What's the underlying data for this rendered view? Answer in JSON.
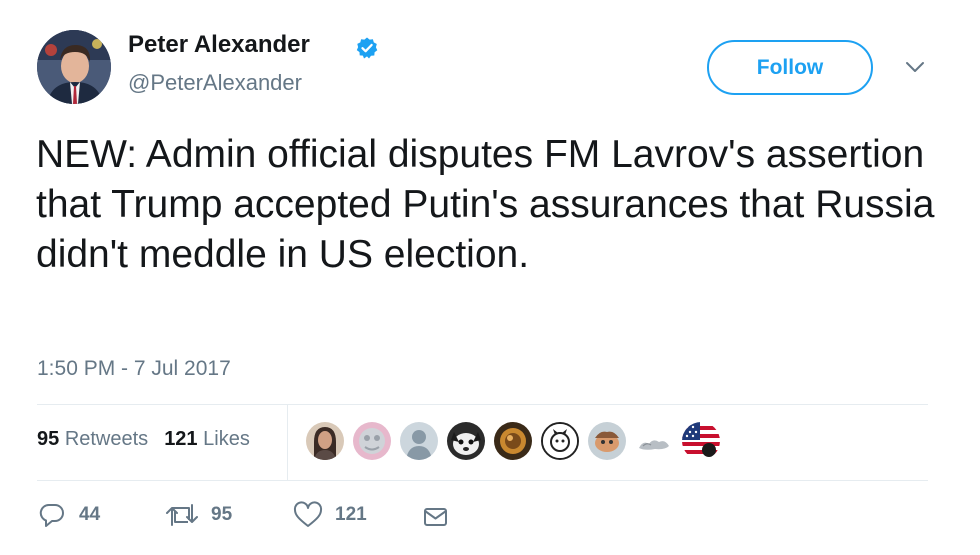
{
  "tweet": {
    "author": {
      "name": "Peter Alexander",
      "handle": "@PeterAlexander",
      "verified": true
    },
    "follow_label": "Follow",
    "text": "NEW: Admin official disputes FM Lavrov's assertion that Trump accepted Putin's assurances that Russia didn't meddle in US election.",
    "timestamp": "1:50 PM - 7 Jul 2017",
    "stats": {
      "retweets_count": "95",
      "retweets_label": "Retweets",
      "likes_count": "121",
      "likes_label": "Likes"
    },
    "actions": {
      "reply_count": "44",
      "retweet_count": "95",
      "like_count": "121"
    }
  },
  "colors": {
    "accent": "#1da1f2",
    "secondary_text": "#657786",
    "primary_text": "#14171a",
    "divider": "#e6ecf0"
  },
  "icons": [
    "verified-badge-icon",
    "caret-down-icon",
    "reply-icon",
    "retweet-icon",
    "heart-icon",
    "envelope-icon"
  ]
}
